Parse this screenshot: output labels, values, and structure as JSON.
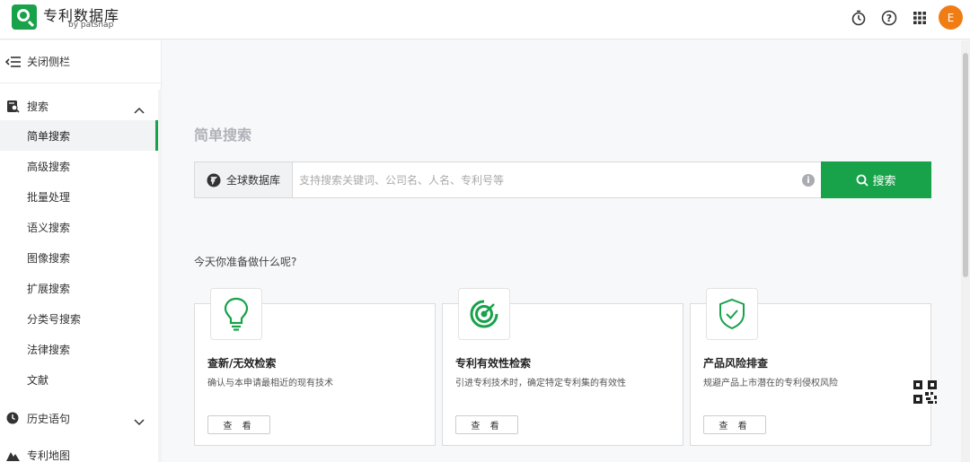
{
  "header": {
    "brand_title": "专利数据库",
    "brand_by": "by patsnap",
    "avatar_initial": "E",
    "icons": [
      "stopwatch-icon",
      "help-icon",
      "apps-grid-icon"
    ]
  },
  "sidebar": {
    "close_label": "关闭侧栏",
    "search_section": "搜索",
    "items": [
      {
        "label": "简单搜索",
        "active": true
      },
      {
        "label": "高级搜索"
      },
      {
        "label": "批量处理"
      },
      {
        "label": "语义搜索"
      },
      {
        "label": "图像搜索"
      },
      {
        "label": "扩展搜索"
      },
      {
        "label": "分类号搜索"
      },
      {
        "label": "法律搜索"
      },
      {
        "label": "文献"
      }
    ],
    "history_section": "历史语句",
    "map_section": "专利地图"
  },
  "main": {
    "title": "简单搜索",
    "database_label": "全球数据库",
    "search_placeholder": "支持搜索关键词、公司名、人名、专利号等",
    "search_button": "搜索",
    "question": "今天你准备做什么呢?",
    "cards": [
      {
        "title": "查新/无效检索",
        "desc": "确认与本申请最相近的现有技术",
        "button": "查 看",
        "icon": "lightbulb-icon"
      },
      {
        "title": "专利有效性检索",
        "desc": "引进专利技术时，确定特定专利集的有效性",
        "button": "查 看",
        "icon": "target-icon"
      },
      {
        "title": "产品风险排查",
        "desc": "规避产品上市潜在的专利侵权风险",
        "button": "查 看",
        "icon": "shield-check-icon"
      }
    ]
  },
  "colors": {
    "accent": "#18a24a",
    "avatar": "#f07d14"
  }
}
